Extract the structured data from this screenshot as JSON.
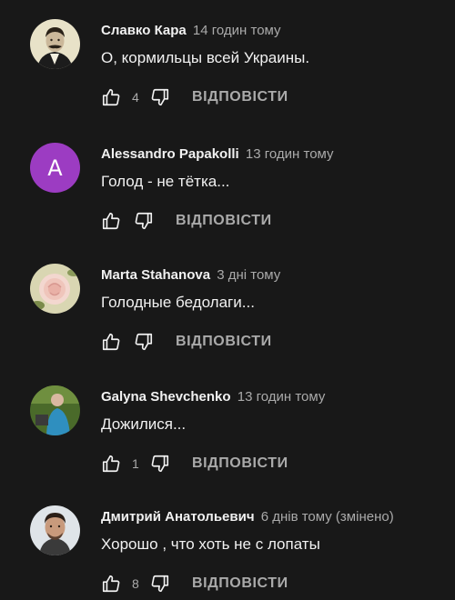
{
  "comments": [
    {
      "author": "Славко Кара",
      "time": "14 годин тому",
      "text": "О, кормильцы всей Украины.",
      "likes": "4",
      "reply_label": "ВІДПОВІСТИ",
      "avatar": {
        "kind": "portrait",
        "bg": "#e8e2c8"
      }
    },
    {
      "author": "Alessandro Papakolli",
      "time": "13 годин тому",
      "text": "Голод - не тётка...",
      "likes": "",
      "reply_label": "ВІДПОВІСТИ",
      "avatar": {
        "kind": "letter",
        "letter": "A",
        "bg": "#9c3cc2"
      }
    },
    {
      "author": "Marta Stahanova",
      "time": "3 дні тому",
      "text": "Голодные бедолаги...",
      "likes": "",
      "reply_label": "ВІДПОВІСТИ",
      "avatar": {
        "kind": "rose",
        "bg": "#d9d6b2"
      }
    },
    {
      "author": "Galyna Shevchenko",
      "time": "13 годин тому",
      "text": "Дожилися...",
      "likes": "1",
      "reply_label": "ВІДПОВІСТИ",
      "avatar": {
        "kind": "outdoor",
        "bg": "#4a6a2a"
      }
    },
    {
      "author": "Дмитрий Анатольевич",
      "time": "6 днів тому (змінено)",
      "text": "Хорошо , что хоть не с лопаты",
      "likes": "8",
      "reply_label": "ВІДПОВІСТИ",
      "avatar": {
        "kind": "man",
        "bg": "#dfe4e8"
      }
    }
  ]
}
